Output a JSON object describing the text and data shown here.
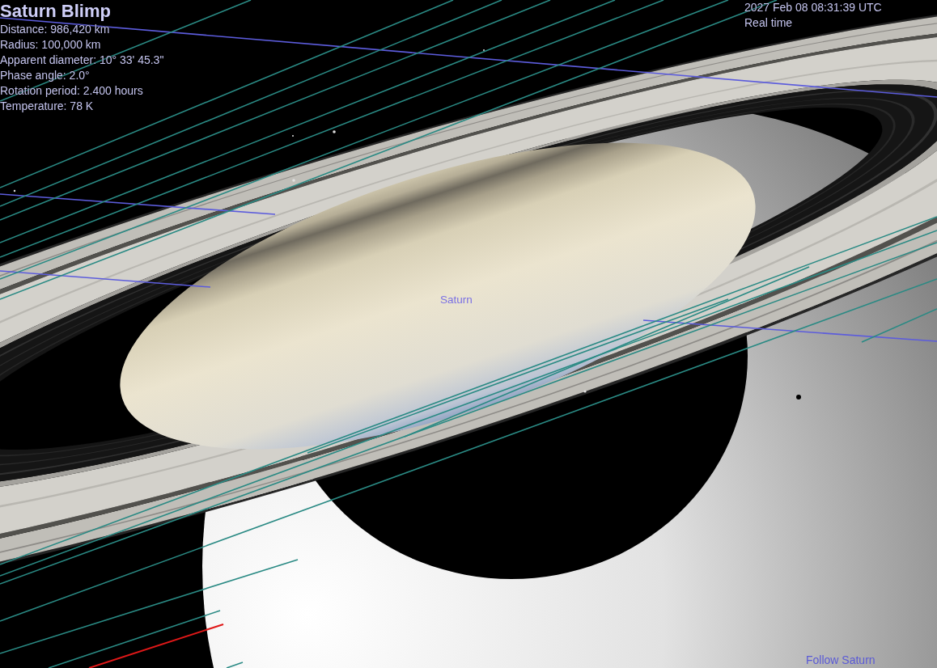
{
  "object_info": {
    "name": "Saturn Blimp",
    "details": [
      "Distance: 986,420 km",
      "Radius: 100,000 km",
      "Apparent diameter: 10° 33' 45.3\"",
      "Phase angle: 2.0°",
      "Rotation period: 2.400 hours",
      "Temperature: 78 K"
    ]
  },
  "time_info": {
    "datetime": "2027 Feb 08 08:31:39 UTC",
    "rate": "Real time"
  },
  "scene": {
    "body_label": "Saturn"
  },
  "status": {
    "message": "Follow Saturn"
  }
}
